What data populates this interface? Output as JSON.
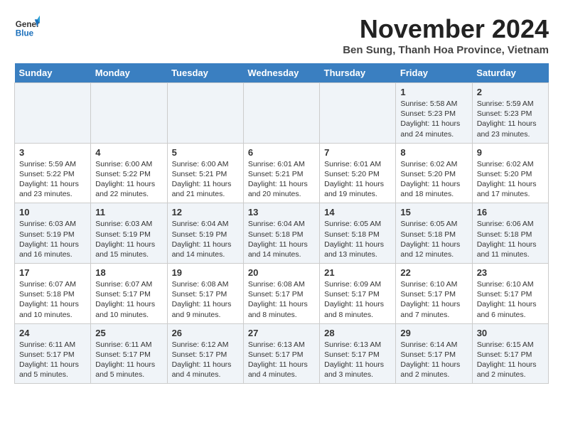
{
  "logo": {
    "general": "General",
    "blue": "Blue"
  },
  "title": "November 2024",
  "location": "Ben Sung, Thanh Hoa Province, Vietnam",
  "weekdays": [
    "Sunday",
    "Monday",
    "Tuesday",
    "Wednesday",
    "Thursday",
    "Friday",
    "Saturday"
  ],
  "weeks": [
    [
      {
        "day": "",
        "info": ""
      },
      {
        "day": "",
        "info": ""
      },
      {
        "day": "",
        "info": ""
      },
      {
        "day": "",
        "info": ""
      },
      {
        "day": "",
        "info": ""
      },
      {
        "day": "1",
        "info": "Sunrise: 5:58 AM\nSunset: 5:23 PM\nDaylight: 11 hours and 24 minutes."
      },
      {
        "day": "2",
        "info": "Sunrise: 5:59 AM\nSunset: 5:23 PM\nDaylight: 11 hours and 23 minutes."
      }
    ],
    [
      {
        "day": "3",
        "info": "Sunrise: 5:59 AM\nSunset: 5:22 PM\nDaylight: 11 hours and 23 minutes."
      },
      {
        "day": "4",
        "info": "Sunrise: 6:00 AM\nSunset: 5:22 PM\nDaylight: 11 hours and 22 minutes."
      },
      {
        "day": "5",
        "info": "Sunrise: 6:00 AM\nSunset: 5:21 PM\nDaylight: 11 hours and 21 minutes."
      },
      {
        "day": "6",
        "info": "Sunrise: 6:01 AM\nSunset: 5:21 PM\nDaylight: 11 hours and 20 minutes."
      },
      {
        "day": "7",
        "info": "Sunrise: 6:01 AM\nSunset: 5:20 PM\nDaylight: 11 hours and 19 minutes."
      },
      {
        "day": "8",
        "info": "Sunrise: 6:02 AM\nSunset: 5:20 PM\nDaylight: 11 hours and 18 minutes."
      },
      {
        "day": "9",
        "info": "Sunrise: 6:02 AM\nSunset: 5:20 PM\nDaylight: 11 hours and 17 minutes."
      }
    ],
    [
      {
        "day": "10",
        "info": "Sunrise: 6:03 AM\nSunset: 5:19 PM\nDaylight: 11 hours and 16 minutes."
      },
      {
        "day": "11",
        "info": "Sunrise: 6:03 AM\nSunset: 5:19 PM\nDaylight: 11 hours and 15 minutes."
      },
      {
        "day": "12",
        "info": "Sunrise: 6:04 AM\nSunset: 5:19 PM\nDaylight: 11 hours and 14 minutes."
      },
      {
        "day": "13",
        "info": "Sunrise: 6:04 AM\nSunset: 5:18 PM\nDaylight: 11 hours and 14 minutes."
      },
      {
        "day": "14",
        "info": "Sunrise: 6:05 AM\nSunset: 5:18 PM\nDaylight: 11 hours and 13 minutes."
      },
      {
        "day": "15",
        "info": "Sunrise: 6:05 AM\nSunset: 5:18 PM\nDaylight: 11 hours and 12 minutes."
      },
      {
        "day": "16",
        "info": "Sunrise: 6:06 AM\nSunset: 5:18 PM\nDaylight: 11 hours and 11 minutes."
      }
    ],
    [
      {
        "day": "17",
        "info": "Sunrise: 6:07 AM\nSunset: 5:18 PM\nDaylight: 11 hours and 10 minutes."
      },
      {
        "day": "18",
        "info": "Sunrise: 6:07 AM\nSunset: 5:17 PM\nDaylight: 11 hours and 10 minutes."
      },
      {
        "day": "19",
        "info": "Sunrise: 6:08 AM\nSunset: 5:17 PM\nDaylight: 11 hours and 9 minutes."
      },
      {
        "day": "20",
        "info": "Sunrise: 6:08 AM\nSunset: 5:17 PM\nDaylight: 11 hours and 8 minutes."
      },
      {
        "day": "21",
        "info": "Sunrise: 6:09 AM\nSunset: 5:17 PM\nDaylight: 11 hours and 8 minutes."
      },
      {
        "day": "22",
        "info": "Sunrise: 6:10 AM\nSunset: 5:17 PM\nDaylight: 11 hours and 7 minutes."
      },
      {
        "day": "23",
        "info": "Sunrise: 6:10 AM\nSunset: 5:17 PM\nDaylight: 11 hours and 6 minutes."
      }
    ],
    [
      {
        "day": "24",
        "info": "Sunrise: 6:11 AM\nSunset: 5:17 PM\nDaylight: 11 hours and 5 minutes."
      },
      {
        "day": "25",
        "info": "Sunrise: 6:11 AM\nSunset: 5:17 PM\nDaylight: 11 hours and 5 minutes."
      },
      {
        "day": "26",
        "info": "Sunrise: 6:12 AM\nSunset: 5:17 PM\nDaylight: 11 hours and 4 minutes."
      },
      {
        "day": "27",
        "info": "Sunrise: 6:13 AM\nSunset: 5:17 PM\nDaylight: 11 hours and 4 minutes."
      },
      {
        "day": "28",
        "info": "Sunrise: 6:13 AM\nSunset: 5:17 PM\nDaylight: 11 hours and 3 minutes."
      },
      {
        "day": "29",
        "info": "Sunrise: 6:14 AM\nSunset: 5:17 PM\nDaylight: 11 hours and 2 minutes."
      },
      {
        "day": "30",
        "info": "Sunrise: 6:15 AM\nSunset: 5:17 PM\nDaylight: 11 hours and 2 minutes."
      }
    ]
  ]
}
